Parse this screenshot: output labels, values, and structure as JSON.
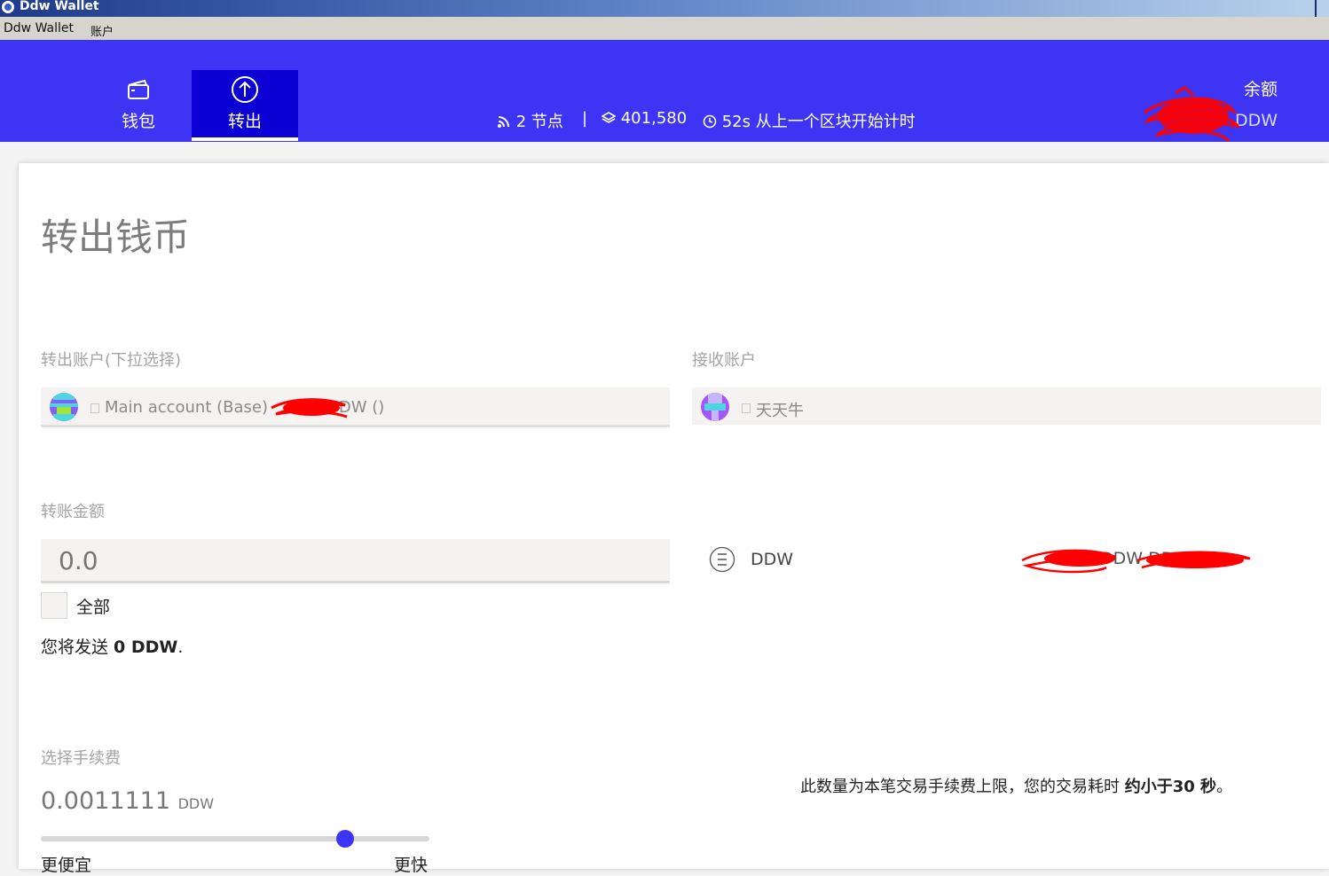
{
  "window": {
    "title": "Ddw Wallet"
  },
  "menu": {
    "items": [
      "Ddw Wallet",
      "账户"
    ]
  },
  "nav": {
    "wallet_label": "钱包",
    "send_label": "转出"
  },
  "status": {
    "peers": "2 节点",
    "separator": "|",
    "block": "401,580",
    "elapsed": "52s 从上一个区块开始计时"
  },
  "balance": {
    "label": "余额",
    "unit": "DDW"
  },
  "page": {
    "title": "转出钱币"
  },
  "from": {
    "label": "转出账户(下拉选择)",
    "account_name": "Main account (Base)",
    "account_suffix": "DDW ()"
  },
  "to": {
    "label": "接收账户",
    "account_name": "天天牛"
  },
  "amount": {
    "label": "转账金额",
    "placeholder": "0.0",
    "currency": "DDW",
    "balance_text": "DDW DDW)",
    "send_all_label": "全部",
    "summary_prefix": "您将发送 ",
    "summary_value": "0 DDW",
    "summary_suffix": "."
  },
  "fee": {
    "label": "选择手续费",
    "value": "0.0011111",
    "unit": "DDW",
    "level": 0.79,
    "cheaper_label": "更便宜",
    "faster_label": "更快",
    "note_prefix": "此数量为本笔交易手续费上限，您的交易耗时 ",
    "note_bold": "约小于30 秒",
    "note_suffix": "。"
  },
  "colors": {
    "header": "#3d34f4",
    "active_tab": "#0b01d5",
    "scribble": "#ff0000"
  },
  "icons": [
    "app-icon",
    "wallet-icon",
    "upload-arrow-icon",
    "rss-icon",
    "layers-icon",
    "clock-icon",
    "chevron-icon",
    "ether-icon"
  ]
}
